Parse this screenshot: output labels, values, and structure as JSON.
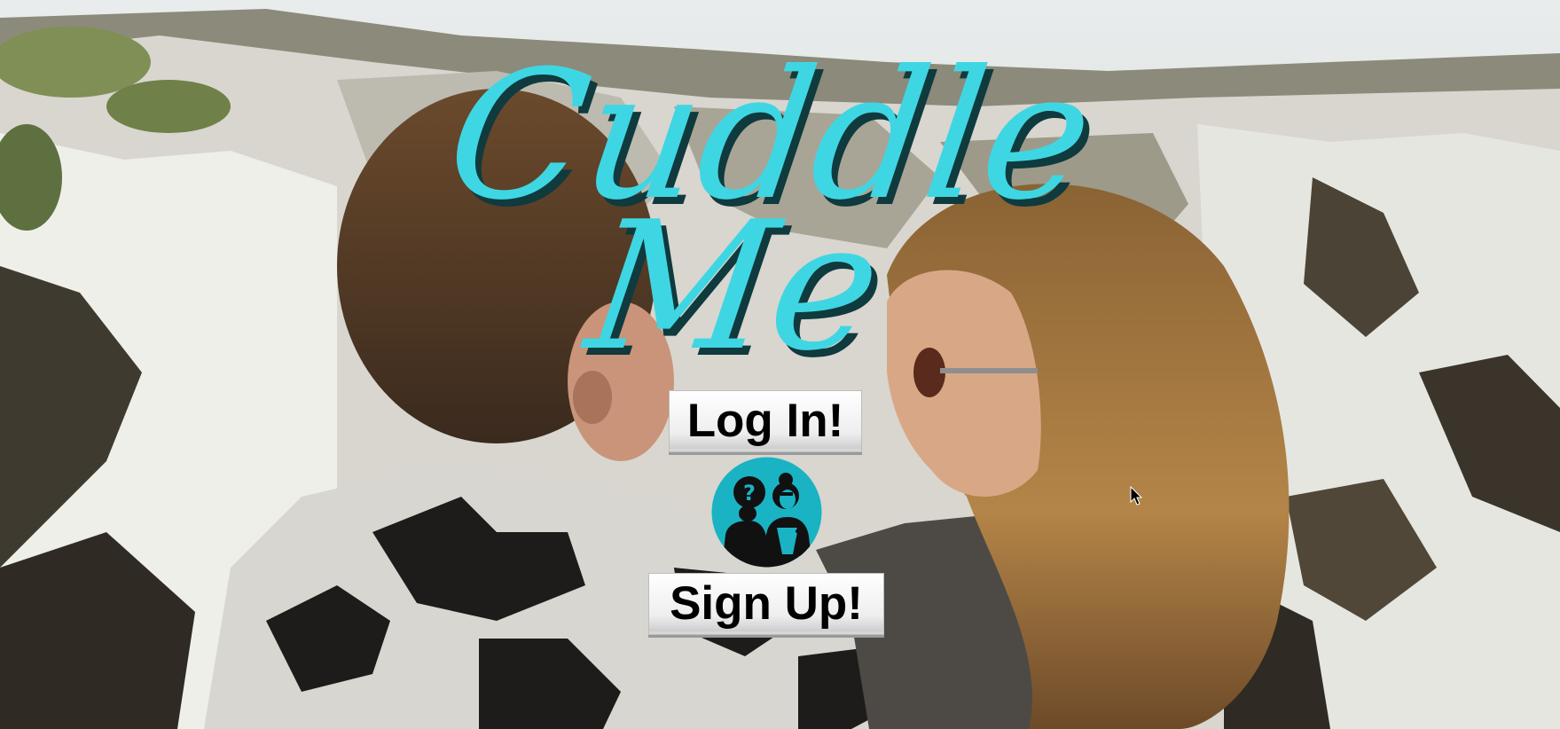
{
  "app": {
    "brand_line1": "Cuddle",
    "brand_line2": "Me"
  },
  "actions": {
    "login_label": "Log In!",
    "signup_label": "Sign Up!"
  },
  "emblem": {
    "icon": "couple-question-icon",
    "question_mark": "?"
  },
  "icons": {
    "cursor": "mouse-pointer-icon"
  },
  "colors": {
    "brand_cyan": "#3fd6e3",
    "brand_shadow": "#0f3a3e",
    "emblem_teal": "#1ab3c4",
    "button_bg": "#eeeeee"
  }
}
